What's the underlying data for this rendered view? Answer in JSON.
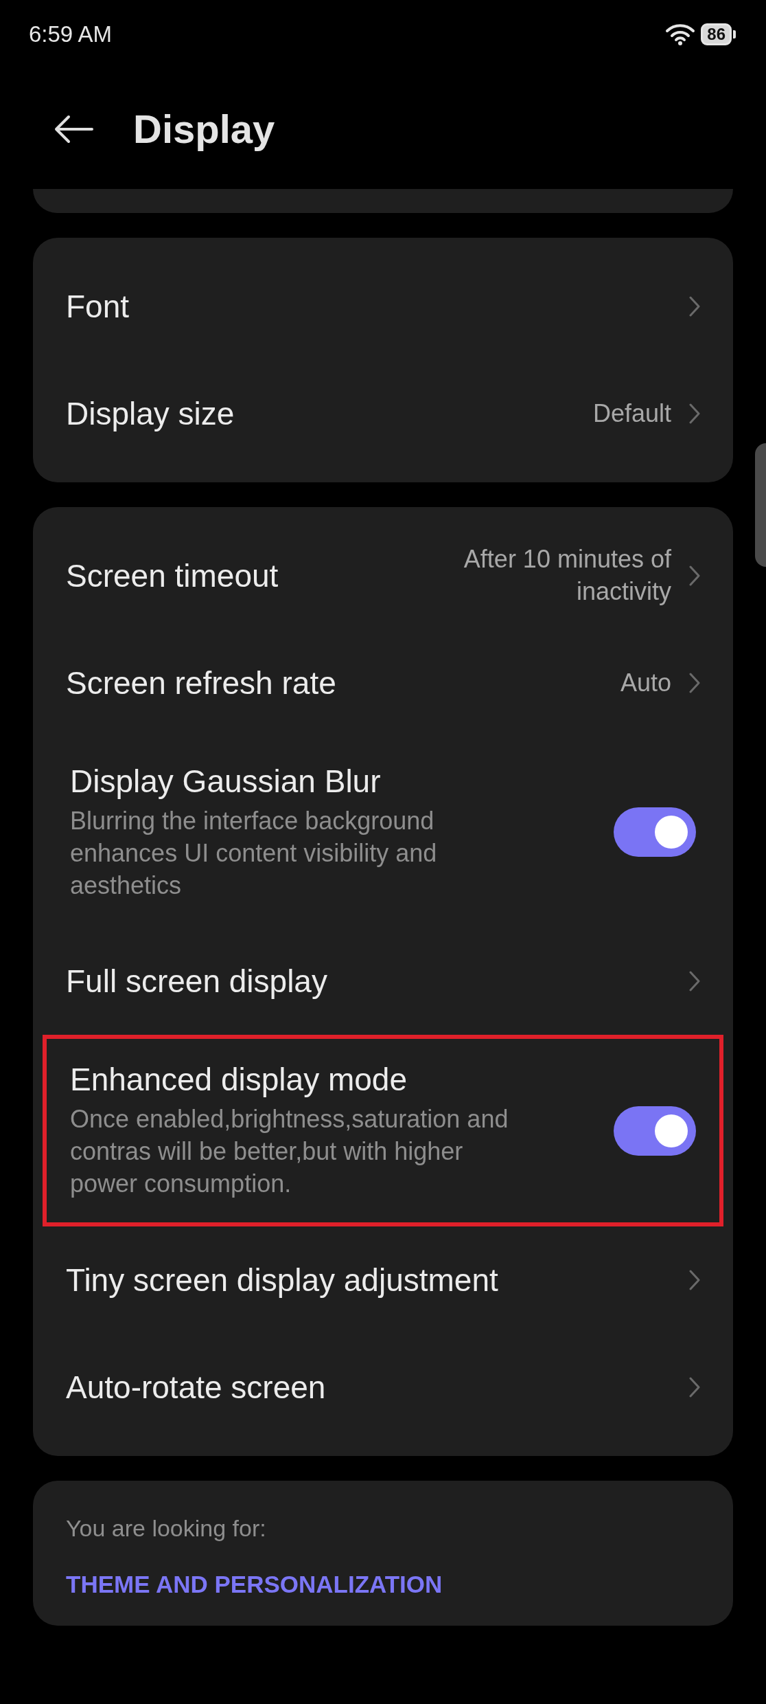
{
  "status_bar": {
    "time": "6:59 AM",
    "battery": "86"
  },
  "header": {
    "title": "Display"
  },
  "groups": [
    {
      "items": [
        {
          "kind": "nav",
          "title": "Font"
        },
        {
          "kind": "nav",
          "title": "Display size",
          "value": "Default"
        }
      ]
    },
    {
      "items": [
        {
          "kind": "nav",
          "title": "Screen timeout",
          "value": "After 10 minutes of inactivity"
        },
        {
          "kind": "nav",
          "title": "Screen refresh rate",
          "value": "Auto"
        },
        {
          "kind": "toggle",
          "title": "Display Gaussian Blur",
          "description": "Blurring the interface background enhances UI content visibility and aesthetics",
          "on": true,
          "highlighted": false
        },
        {
          "kind": "nav",
          "title": "Full screen display"
        },
        {
          "kind": "toggle",
          "title": "Enhanced display mode",
          "description": "Once enabled,brightness,saturation and contras will be better,but with higher power consumption.",
          "on": true,
          "highlighted": true
        },
        {
          "kind": "nav",
          "title": "Tiny screen display adjustment"
        },
        {
          "kind": "nav",
          "title": "Auto-rotate screen"
        }
      ]
    }
  ],
  "suggestion": {
    "label": "You are looking for:",
    "link": "THEME AND PERSONALIZATION"
  }
}
